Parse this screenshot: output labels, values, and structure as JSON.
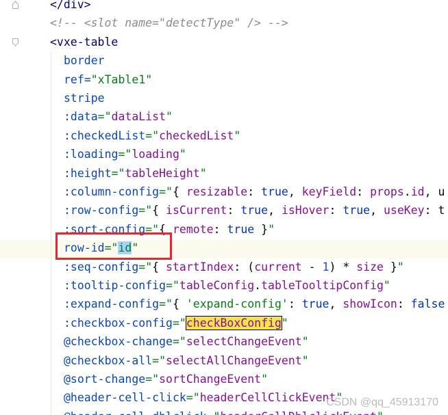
{
  "editor": {
    "lines": [
      {
        "indent": 0,
        "tokens": [
          {
            "t": "</div>",
            "c": "tok-tag"
          }
        ]
      },
      {
        "indent": 0,
        "tokens": [
          {
            "t": "<!-- <slot name=\"detectType\" /> -->",
            "c": "tok-comment"
          }
        ]
      },
      {
        "indent": 0,
        "tokens": [
          {
            "t": "<vxe-table",
            "c": "tok-tag"
          }
        ]
      },
      {
        "indent": 1,
        "tokens": [
          {
            "t": "border",
            "c": "tok-attr"
          }
        ]
      },
      {
        "indent": 1,
        "tokens": [
          {
            "t": "ref",
            "c": "tok-attr"
          },
          {
            "t": "=",
            "c": "tok-eq"
          },
          {
            "t": "\"xTable1\"",
            "c": "tok-str"
          }
        ]
      },
      {
        "indent": 1,
        "tokens": [
          {
            "t": "stripe",
            "c": "tok-attr"
          }
        ]
      },
      {
        "indent": 1,
        "tokens": [
          {
            "t": ":data",
            "c": "tok-attr"
          },
          {
            "t": "=\"",
            "c": "tok-str"
          },
          {
            "t": "dataList",
            "c": "tok-prop"
          },
          {
            "t": "\"",
            "c": "tok-str"
          }
        ]
      },
      {
        "indent": 1,
        "tokens": [
          {
            "t": ":checkedList",
            "c": "tok-attr"
          },
          {
            "t": "=\"",
            "c": "tok-str"
          },
          {
            "t": "checkedList",
            "c": "tok-prop"
          },
          {
            "t": "\"",
            "c": "tok-str"
          }
        ]
      },
      {
        "indent": 1,
        "tokens": [
          {
            "t": ":loading",
            "c": "tok-attr"
          },
          {
            "t": "=\"",
            "c": "tok-str"
          },
          {
            "t": "loading",
            "c": "tok-prop"
          },
          {
            "t": "\"",
            "c": "tok-str"
          }
        ]
      },
      {
        "indent": 1,
        "tokens": [
          {
            "t": ":height",
            "c": "tok-attr"
          },
          {
            "t": "=\"",
            "c": "tok-str"
          },
          {
            "t": "tableHeight",
            "c": "tok-prop"
          },
          {
            "t": "\"",
            "c": "tok-str"
          }
        ]
      },
      {
        "indent": 1,
        "tokens": [
          {
            "t": ":column-config",
            "c": "tok-attr"
          },
          {
            "t": "=\"",
            "c": "tok-str"
          },
          {
            "t": "{ ",
            "c": "tok-plain"
          },
          {
            "t": "resizable",
            "c": "tok-prop"
          },
          {
            "t": ": ",
            "c": "tok-plain"
          },
          {
            "t": "true",
            "c": "tok-kw"
          },
          {
            "t": ", ",
            "c": "tok-plain"
          },
          {
            "t": "keyField",
            "c": "tok-prop"
          },
          {
            "t": ": ",
            "c": "tok-plain"
          },
          {
            "t": "props",
            "c": "tok-prop"
          },
          {
            "t": ".",
            "c": "tok-plain"
          },
          {
            "t": "id",
            "c": "tok-prop"
          },
          {
            "t": ", u",
            "c": "tok-plain"
          }
        ]
      },
      {
        "indent": 1,
        "tokens": [
          {
            "t": ":row-config",
            "c": "tok-attr"
          },
          {
            "t": "=\"",
            "c": "tok-str"
          },
          {
            "t": "{ ",
            "c": "tok-plain"
          },
          {
            "t": "isCurrent",
            "c": "tok-prop"
          },
          {
            "t": ": ",
            "c": "tok-plain"
          },
          {
            "t": "true",
            "c": "tok-kw"
          },
          {
            "t": ", ",
            "c": "tok-plain"
          },
          {
            "t": "isHover",
            "c": "tok-prop"
          },
          {
            "t": ": ",
            "c": "tok-plain"
          },
          {
            "t": "true",
            "c": "tok-kw"
          },
          {
            "t": ", ",
            "c": "tok-plain"
          },
          {
            "t": "useKey",
            "c": "tok-prop"
          },
          {
            "t": ": t",
            "c": "tok-plain"
          }
        ]
      },
      {
        "indent": 1,
        "tokens": [
          {
            "t": ":sort-config",
            "c": "tok-attr"
          },
          {
            "t": "=\"",
            "c": "tok-str"
          },
          {
            "t": "{ ",
            "c": "tok-plain"
          },
          {
            "t": "remote",
            "c": "tok-prop"
          },
          {
            "t": ": ",
            "c": "tok-plain"
          },
          {
            "t": "true",
            "c": "tok-kw"
          },
          {
            "t": " }",
            "c": "tok-plain"
          },
          {
            "t": "\"",
            "c": "tok-str"
          }
        ]
      },
      {
        "indent": 1,
        "tokens": [
          {
            "t": "row-id",
            "c": "tok-attr"
          },
          {
            "t": "=\"",
            "c": "tok-str"
          },
          {
            "t": "id",
            "c": "tok-str tok-selected"
          },
          {
            "t": "\"",
            "c": "tok-str"
          }
        ]
      },
      {
        "indent": 1,
        "tokens": [
          {
            "t": ":seq-config",
            "c": "tok-attr"
          },
          {
            "t": "=\"",
            "c": "tok-str"
          },
          {
            "t": "{ ",
            "c": "tok-plain"
          },
          {
            "t": "startIndex",
            "c": "tok-prop"
          },
          {
            "t": ": (",
            "c": "tok-plain"
          },
          {
            "t": "current",
            "c": "tok-prop"
          },
          {
            "t": " - ",
            "c": "tok-plain"
          },
          {
            "t": "1",
            "c": "tok-num"
          },
          {
            "t": ") * ",
            "c": "tok-plain"
          },
          {
            "t": "size",
            "c": "tok-prop"
          },
          {
            "t": " }",
            "c": "tok-plain"
          },
          {
            "t": "\"",
            "c": "tok-str"
          }
        ]
      },
      {
        "indent": 1,
        "tokens": [
          {
            "t": ":tooltip-config",
            "c": "tok-attr"
          },
          {
            "t": "=\"",
            "c": "tok-str"
          },
          {
            "t": "tableConfig",
            "c": "tok-prop"
          },
          {
            "t": ".",
            "c": "tok-plain"
          },
          {
            "t": "tableTooltipConfig",
            "c": "tok-prop"
          },
          {
            "t": "\"",
            "c": "tok-str"
          }
        ]
      },
      {
        "indent": 1,
        "tokens": [
          {
            "t": ":expand-config",
            "c": "tok-attr"
          },
          {
            "t": "=\"",
            "c": "tok-str"
          },
          {
            "t": "{ ",
            "c": "tok-plain"
          },
          {
            "t": "'expand-config'",
            "c": "tok-str"
          },
          {
            "t": ": ",
            "c": "tok-plain"
          },
          {
            "t": "true",
            "c": "tok-kw"
          },
          {
            "t": ", ",
            "c": "tok-plain"
          },
          {
            "t": "showIcon",
            "c": "tok-prop"
          },
          {
            "t": ": ",
            "c": "tok-plain"
          },
          {
            "t": "false",
            "c": "tok-kw"
          }
        ]
      },
      {
        "indent": 1,
        "tokens": [
          {
            "t": ":checkbox-config",
            "c": "tok-attr"
          },
          {
            "t": "=\"",
            "c": "tok-str"
          },
          {
            "t": "checkBoxConfig",
            "c": "tok-prop tok-search"
          },
          {
            "t": "\"",
            "c": "tok-str"
          }
        ]
      },
      {
        "indent": 1,
        "tokens": [
          {
            "t": "@checkbox-change",
            "c": "tok-attr"
          },
          {
            "t": "=\"",
            "c": "tok-str"
          },
          {
            "t": "selectChangeEvent",
            "c": "tok-prop"
          },
          {
            "t": "\"",
            "c": "tok-str"
          }
        ]
      },
      {
        "indent": 1,
        "tokens": [
          {
            "t": "@checkbox-all",
            "c": "tok-attr"
          },
          {
            "t": "=\"",
            "c": "tok-str"
          },
          {
            "t": "selectAllChangeEvent",
            "c": "tok-prop"
          },
          {
            "t": "\"",
            "c": "tok-str"
          }
        ]
      },
      {
        "indent": 1,
        "tokens": [
          {
            "t": "@sort-change",
            "c": "tok-attr"
          },
          {
            "t": "=\"",
            "c": "tok-str"
          },
          {
            "t": "sortChangeEvent",
            "c": "tok-prop"
          },
          {
            "t": "\"",
            "c": "tok-str"
          }
        ]
      },
      {
        "indent": 1,
        "tokens": [
          {
            "t": "@header-cell-click",
            "c": "tok-attr"
          },
          {
            "t": "=\"",
            "c": "tok-str"
          },
          {
            "t": "headerCellClickEvent",
            "c": "tok-prop"
          },
          {
            "t": "\"",
            "c": "tok-str"
          }
        ]
      },
      {
        "indent": 1,
        "tokens": [
          {
            "t": "@header-cell-dblclick",
            "c": "tok-attr"
          },
          {
            "t": "=\"",
            "c": "tok-str"
          },
          {
            "t": "headerCellDblclickEvent",
            "c": "tok-prop"
          },
          {
            "t": "\"",
            "c": "tok-str"
          }
        ]
      }
    ]
  },
  "watermark": "CSDN @qq_45913170"
}
